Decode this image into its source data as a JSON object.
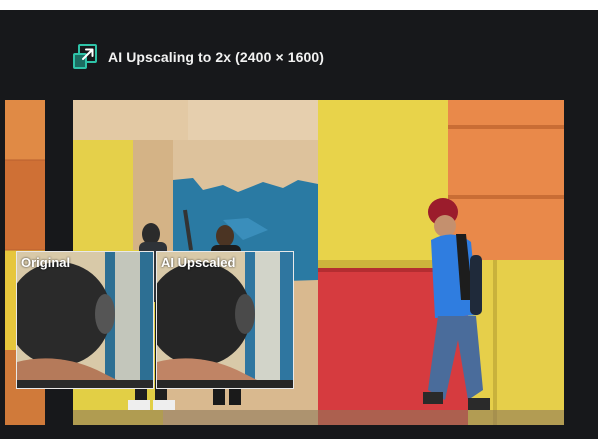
{
  "header": {
    "title": "AI Upscaling to 2x (2400 × 1600)",
    "icon": "upscale-icon"
  },
  "comparison": {
    "original_label": "Original",
    "upscaled_label": "AI Upscaled"
  },
  "colors": {
    "background": "#17181b",
    "accent": "#2fc3a8",
    "text": "#f2f2f2"
  }
}
